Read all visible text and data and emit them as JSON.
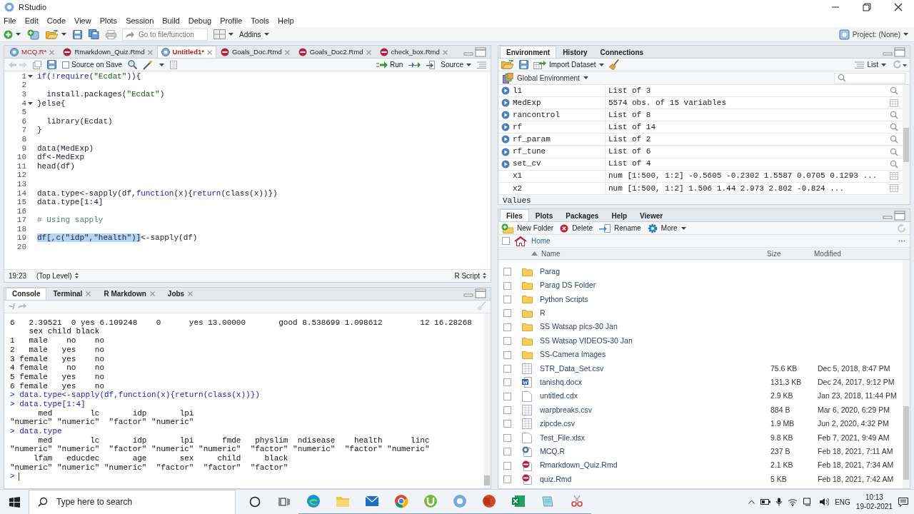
{
  "window": {
    "title": "RStudio"
  },
  "menu": [
    "File",
    "Edit",
    "Code",
    "View",
    "Plots",
    "Session",
    "Build",
    "Debug",
    "Profile",
    "Tools",
    "Help"
  ],
  "toolbar": {
    "goto_placeholder": "Go to file/function",
    "addins": "Addins",
    "project": "Project: (None)"
  },
  "editor": {
    "tabs": [
      {
        "label": "MCQ.R*",
        "kind": "r",
        "modified": true,
        "selected": false
      },
      {
        "label": "Rmarkdown_Quiz.Rmd",
        "kind": "rmd",
        "modified": false,
        "selected": false
      },
      {
        "label": "Untitled1*",
        "kind": "r",
        "modified": true,
        "selected": true
      },
      {
        "label": "Goals_Doc.Rmd",
        "kind": "rmd",
        "modified": false,
        "selected": false
      },
      {
        "label": "Goals_Doc2.Rmd",
        "kind": "rmd",
        "modified": false,
        "selected": false
      },
      {
        "label": "check_box.Rmd",
        "kind": "rmd",
        "modified": false,
        "selected": false
      }
    ],
    "source_on_save": {
      "label": "Source on Save",
      "checked": false
    },
    "run": "Run",
    "source": "Source",
    "lines": [
      {
        "number": "1",
        "fold": true,
        "segments": [
          {
            "text": "if",
            "kind": "keyword"
          },
          {
            "text": "(!",
            "kind": "plain"
          },
          {
            "text": "require",
            "kind": "keyword"
          },
          {
            "text": "(",
            "kind": "plain"
          },
          {
            "text": "\"Ecdat\"",
            "kind": "string"
          },
          {
            "text": ")){",
            "kind": "plain"
          }
        ]
      },
      {
        "number": "2",
        "fold": false
      },
      {
        "number": "3",
        "fold": false,
        "segments": [
          {
            "text": "  install.packages(",
            "kind": "plain"
          },
          {
            "text": "\"Ecdat\"",
            "kind": "string"
          },
          {
            "text": ")",
            "kind": "plain"
          }
        ]
      },
      {
        "number": "4",
        "fold": true,
        "segments": [
          {
            "text": "}else{",
            "kind": "plain"
          }
        ]
      },
      {
        "number": "5",
        "fold": false
      },
      {
        "number": "6",
        "fold": false,
        "segments": [
          {
            "text": "  library(Ecdat)",
            "kind": "plain"
          }
        ]
      },
      {
        "number": "7",
        "fold": false,
        "segments": [
          {
            "text": "}",
            "kind": "plain"
          }
        ]
      },
      {
        "number": "8",
        "fold": false
      },
      {
        "number": "9",
        "fold": false,
        "segments": [
          {
            "text": "data(MedExp)",
            "kind": "plain"
          }
        ]
      },
      {
        "number": "10",
        "fold": false,
        "segments": [
          {
            "text": "df<-MedExp",
            "kind": "plain"
          }
        ]
      },
      {
        "number": "11",
        "fold": false,
        "segments": [
          {
            "text": "head(df)",
            "kind": "plain"
          }
        ]
      },
      {
        "number": "12",
        "fold": false
      },
      {
        "number": "13",
        "fold": false
      },
      {
        "number": "14",
        "fold": false,
        "segments": [
          {
            "text": "data.type<-sapply(df,",
            "kind": "plain"
          },
          {
            "text": "function",
            "kind": "keyword"
          },
          {
            "text": "(x){",
            "kind": "plain"
          },
          {
            "text": "return",
            "kind": "keyword"
          },
          {
            "text": "(class(x))})",
            "kind": "plain"
          }
        ]
      },
      {
        "number": "15",
        "fold": false,
        "segments": [
          {
            "text": "data.type[1:4]",
            "kind": "plain"
          }
        ]
      },
      {
        "number": "16",
        "fold": false
      },
      {
        "number": "17",
        "fold": false,
        "segments": [
          {
            "text": "# Using sapply",
            "kind": "comment"
          }
        ]
      },
      {
        "number": "18",
        "fold": false
      },
      {
        "number": "19",
        "fold": false,
        "segments": [
          {
            "text": "df[,c(\"idp\",\"health\")]",
            "kind": "selection"
          },
          {
            "text": "<-sapply(df)",
            "kind": "plain"
          }
        ]
      },
      {
        "number": "20",
        "fold": false
      }
    ],
    "cursor": "19:23",
    "scope": "(Top Level)",
    "file_type": "R Script"
  },
  "console": {
    "tabs": [
      {
        "label": "Console",
        "closable": false,
        "selected": true
      },
      {
        "label": "Terminal",
        "closable": true,
        "selected": false
      },
      {
        "label": "R Markdown",
        "closable": true,
        "selected": false
      },
      {
        "label": "Jobs",
        "closable": true,
        "selected": false
      }
    ],
    "path": "~/",
    "lines": [
      {
        "kind": "output",
        "text": "6   2.39521  0 yes 6.109248    0      yes 13.00000       good 8.538699 1.098612        12 16.28268"
      },
      {
        "kind": "output",
        "text": "    sex child black"
      },
      {
        "kind": "output",
        "text": "1   male    no    no"
      },
      {
        "kind": "output",
        "text": "2   male   yes    no"
      },
      {
        "kind": "output",
        "text": "3 female   yes    no"
      },
      {
        "kind": "output",
        "text": "4 female    no    no"
      },
      {
        "kind": "output",
        "text": "5 female   yes    no"
      },
      {
        "kind": "output",
        "text": "6 female   yes    no"
      },
      {
        "kind": "input",
        "text": "> data.type<-sapply(df,function(x){return(class(x))})"
      },
      {
        "kind": "input",
        "text": "> data.type[1:4]"
      },
      {
        "kind": "output",
        "text": "      med        lc       idp       lpi "
      },
      {
        "kind": "output",
        "text": "\"numeric\" \"numeric\"  \"factor\" \"numeric\" "
      },
      {
        "kind": "input",
        "text": "> data.type"
      },
      {
        "kind": "output",
        "text": "      med        lc       idp       lpi      fmde   physlim  ndisease    health      linc "
      },
      {
        "kind": "output",
        "text": "\"numeric\" \"numeric\"  \"factor\" \"numeric\" \"numeric\"  \"factor\" \"numeric\"  \"factor\" \"numeric\" "
      },
      {
        "kind": "output",
        "text": "     lfam   educdec       age       sex     child     black "
      },
      {
        "kind": "output",
        "text": "\"numeric\" \"numeric\" \"numeric\"  \"factor\"  \"factor\"  \"factor\" "
      },
      {
        "kind": "prompt",
        "text": ">"
      }
    ]
  },
  "environment": {
    "tabs": [
      {
        "label": "Environment",
        "selected": true
      },
      {
        "label": "History",
        "selected": false
      },
      {
        "label": "Connections",
        "selected": false
      }
    ],
    "import": "Import Dataset",
    "view": "List",
    "scope": "Global Environment",
    "rows": [
      {
        "name": "l1",
        "value": "List of 3",
        "expandable": true,
        "kind": "list"
      },
      {
        "name": "MedExp",
        "value": "5574 obs. of 15 variables",
        "expandable": true,
        "kind": "data"
      },
      {
        "name": "rancontrol",
        "value": "List of 8",
        "expandable": true,
        "kind": "list"
      },
      {
        "name": "rf",
        "value": "List of 14",
        "expandable": true,
        "kind": "list"
      },
      {
        "name": "rf_param",
        "value": "List of 2",
        "expandable": true,
        "kind": "list"
      },
      {
        "name": "rf_tune",
        "value": "List of 6",
        "expandable": true,
        "kind": "list"
      },
      {
        "name": "set_cv",
        "value": "List of 4",
        "expandable": true,
        "kind": "list"
      },
      {
        "name": "x1",
        "value": "num [1:500, 1:2] -0.5605 -0.2302 1.5587 0.0705 0.1293 ...",
        "expandable": false,
        "kind": "data"
      },
      {
        "name": "x2",
        "value": "num [1:500, 1:2] 1.506 1.44 2.973 2.802 -0.824 ...",
        "expandable": false,
        "kind": "data"
      }
    ],
    "section": "Values"
  },
  "files": {
    "tabs": [
      {
        "label": "Files",
        "selected": true
      },
      {
        "label": "Plots",
        "selected": false
      },
      {
        "label": "Packages",
        "selected": false
      },
      {
        "label": "Help",
        "selected": false
      },
      {
        "label": "Viewer",
        "selected": false
      }
    ],
    "actions": [
      {
        "label": "New Folder",
        "kind": "new-folder"
      },
      {
        "label": "Delete",
        "kind": "delete"
      },
      {
        "label": "Rename",
        "kind": "rename"
      },
      {
        "label": "More",
        "kind": "more"
      }
    ],
    "select_all": {
      "checked": false
    },
    "breadcrumb": "Home",
    "columns": [
      "Name",
      "Size",
      "Modified"
    ],
    "rows": [
      {
        "kind": "folder",
        "name": "Parag",
        "checked": false
      },
      {
        "kind": "folder",
        "name": "Parag DS Folder",
        "checked": false
      },
      {
        "kind": "folder",
        "name": "Python Scripts",
        "checked": false
      },
      {
        "kind": "folder",
        "name": "R",
        "checked": false
      },
      {
        "kind": "folder",
        "name": "SS Watsap pics-30 Jan",
        "checked": false
      },
      {
        "kind": "folder",
        "name": "SS Watsap VIDEOS-30 Jan",
        "checked": false
      },
      {
        "kind": "folder",
        "name": "SS-Camera Images",
        "checked": false
      },
      {
        "kind": "table",
        "name": "STR_Data_Set.csv",
        "size": "75.6 KB",
        "modified": "Dec 5, 2018, 8:47 PM",
        "checked": false
      },
      {
        "kind": "word",
        "name": "tanishq.docx",
        "size": "131.3 KB",
        "modified": "Dec 24, 2017, 9:12 PM",
        "checked": false
      },
      {
        "kind": "blank",
        "name": "untitled.cdx",
        "size": "2.9 KB",
        "modified": "Jan 23, 2018, 11:44 PM",
        "checked": false
      },
      {
        "kind": "table",
        "name": "warpbreaks.csv",
        "size": "884 B",
        "modified": "Mar 6, 2020, 6:29 PM",
        "checked": false
      },
      {
        "kind": "table",
        "name": "zipcde.csv",
        "size": "1.9 MB",
        "modified": "Jun 2, 2020, 4:32 PM",
        "checked": false
      },
      {
        "kind": "blank",
        "name": "Test_File.xlsx",
        "size": "9.8 KB",
        "modified": "Feb 7, 2021, 9:49 AM",
        "checked": false
      },
      {
        "kind": "r",
        "name": "MCQ.R",
        "size": "237 B",
        "modified": "Feb 18, 2021, 7:11 AM",
        "checked": false
      },
      {
        "kind": "rmd",
        "name": "Rmarkdown_Quiz.Rmd",
        "size": "2.1 KB",
        "modified": "Feb 18, 2021, 7:34 AM",
        "checked": false
      },
      {
        "kind": "rmd",
        "name": "quiz.Rmd",
        "size": "5 KB",
        "modified": "Feb 18, 2021, 7:42 AM",
        "checked": false
      }
    ]
  },
  "taskbar": {
    "search_placeholder": "Type here to search",
    "language": "ENG",
    "time": "10:13",
    "date": "19-02-2021"
  }
}
